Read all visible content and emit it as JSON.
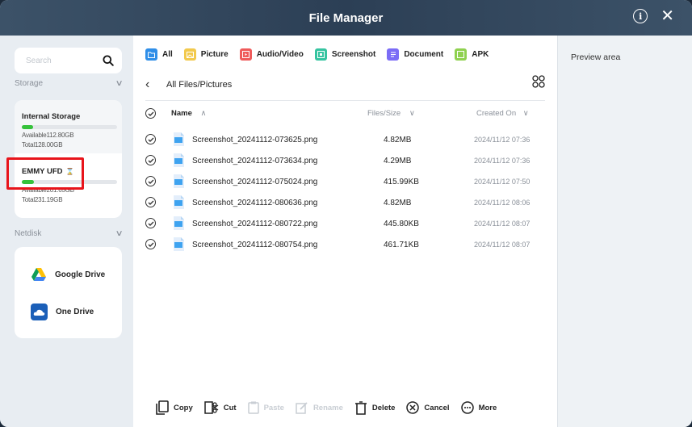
{
  "window": {
    "title": "File Manager"
  },
  "sidebar": {
    "search_placeholder": "Search",
    "storage_label": "Storage",
    "storages": [
      {
        "name": "Internal Storage",
        "available": "Available112.80GB",
        "total": "Total128.00GB",
        "used_fraction": 0.12
      },
      {
        "name": "EMMY UFD",
        "available": "Available201.65GB",
        "total": "Total231.19GB",
        "used_fraction": 0.13
      }
    ],
    "netdisk_label": "Netdisk",
    "clouds": [
      {
        "name": "Google Drive",
        "icon": "google-drive-icon"
      },
      {
        "name": "One Drive",
        "icon": "onedrive-icon"
      }
    ]
  },
  "filters": [
    {
      "label": "All",
      "color": "#2f8ee8",
      "selected": true
    },
    {
      "label": "Picture",
      "color": "#f2c94c"
    },
    {
      "label": "Audio/Video",
      "color": "#ef5a5a"
    },
    {
      "label": "Screenshot",
      "color": "#35c4a0"
    },
    {
      "label": "Document",
      "color": "#7b6cf6"
    },
    {
      "label": "APK",
      "color": "#8fd14f"
    }
  ],
  "path": "All Files/Pictures",
  "table": {
    "headers": {
      "name": "Name",
      "size": "Files/Size",
      "date": "Created On"
    },
    "rows": [
      {
        "name": "Screenshot_20241112-073625.png",
        "size": "4.82MB",
        "date": "2024/11/12 07:36"
      },
      {
        "name": "Screenshot_20241112-073634.png",
        "size": "4.29MB",
        "date": "2024/11/12 07:36"
      },
      {
        "name": "Screenshot_20241112-075024.png",
        "size": "415.99KB",
        "date": "2024/11/12 07:50"
      },
      {
        "name": "Screenshot_20241112-080636.png",
        "size": "4.82MB",
        "date": "2024/11/12 08:06"
      },
      {
        "name": "Screenshot_20241112-080722.png",
        "size": "445.80KB",
        "date": "2024/11/12 08:07"
      },
      {
        "name": "Screenshot_20241112-080754.png",
        "size": "461.71KB",
        "date": "2024/11/12 08:07"
      }
    ]
  },
  "toolbar": {
    "copy": "Copy",
    "cut": "Cut",
    "paste": "Paste",
    "rename": "Rename",
    "delete": "Delete",
    "cancel": "Cancel",
    "more": "More"
  },
  "preview": {
    "label": "Preview area"
  },
  "colors": {
    "highlight": "#e8141b",
    "usage_bar": "#35c23b",
    "titlebar": "#2c3f55"
  }
}
